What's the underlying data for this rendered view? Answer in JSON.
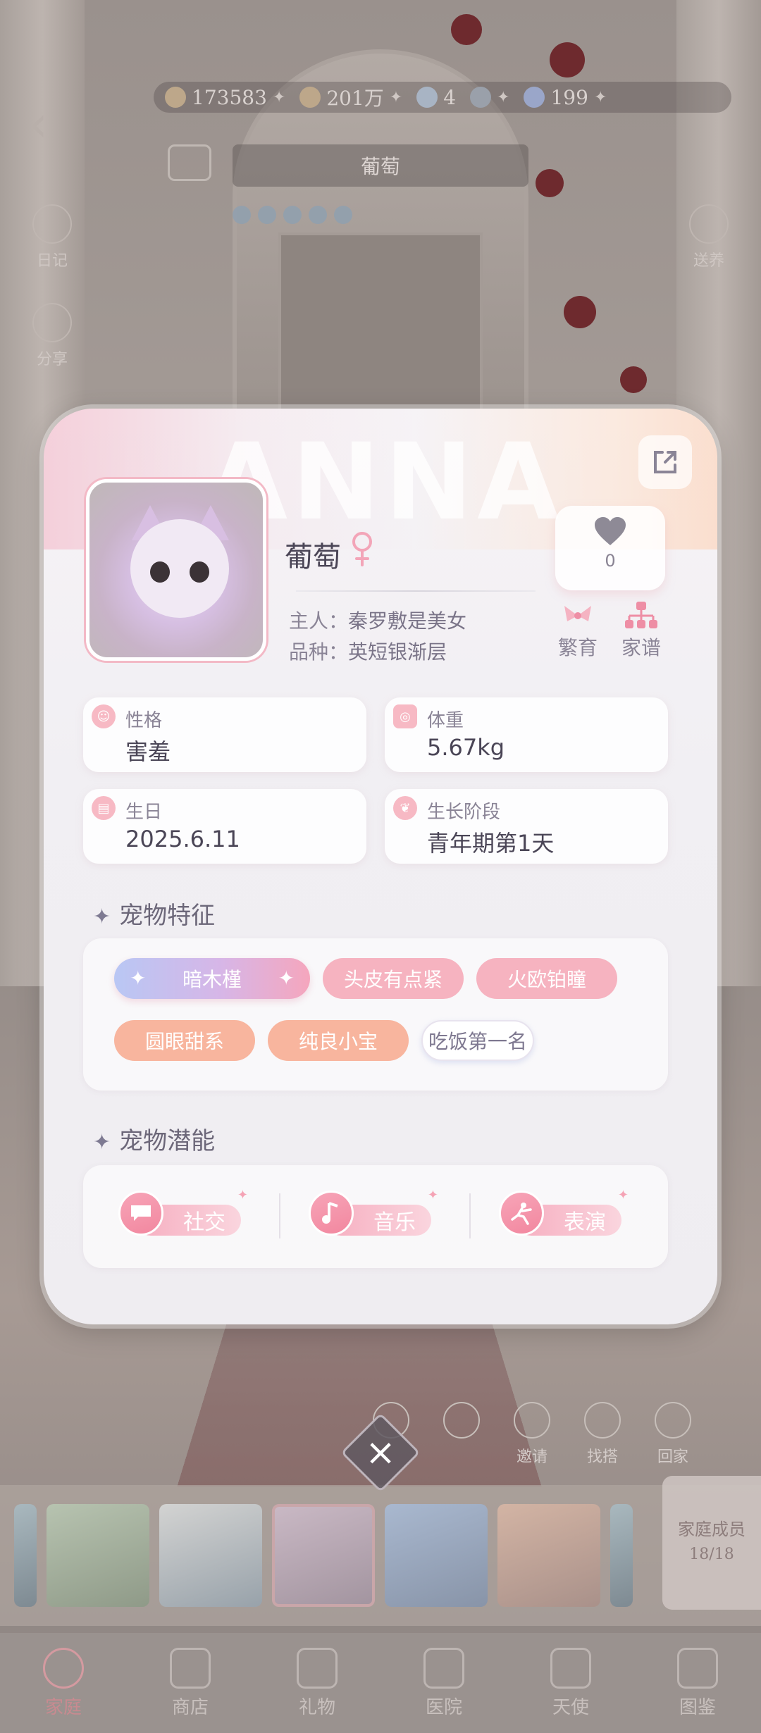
{
  "resources": [
    {
      "icon": "coin-bag-icon",
      "value": "173583"
    },
    {
      "icon": "gold-coin-icon",
      "value": "201万"
    },
    {
      "icon": "diamond-icon",
      "value": "4"
    },
    {
      "icon": "ticket-icon",
      "value": ""
    },
    {
      "icon": "gem-icon",
      "value": "199"
    }
  ],
  "top": {
    "pet_name_bar": "葡萄",
    "left_buttons": [
      "日记",
      "分享"
    ],
    "right_buttons": [
      "送养"
    ]
  },
  "card": {
    "watermark": "ANNA",
    "pet_name": "葡萄",
    "likes": "0",
    "owner_label": "主人：",
    "owner": "秦罗敷是美女",
    "breed_label": "品种：",
    "breed": "英短银渐层",
    "actions": {
      "breed": "繁育",
      "family_tree": "家谱"
    },
    "stats": {
      "personality": {
        "label": "性格",
        "value": "害羞"
      },
      "weight": {
        "label": "体重",
        "value": "5.67kg"
      },
      "birthday": {
        "label": "生日",
        "value": "2025.6.11"
      },
      "stage": {
        "label": "生长阶段",
        "value": "青年期第1天"
      }
    },
    "traits_title": "宠物特征",
    "traits": [
      "暗木槿",
      "头皮有点紧",
      "火欧铂瞳",
      "圆眼甜系",
      "纯良小宝",
      "吃饭第一名"
    ],
    "potential_title": "宠物潜能",
    "potentials": [
      "社交",
      "音乐",
      "表演"
    ]
  },
  "bottom_actions": [
    "",
    "",
    "邀请",
    "找搭",
    "回家"
  ],
  "family": {
    "label": "家庭成员",
    "count": "18/18"
  },
  "nav": [
    "家庭",
    "商店",
    "礼物",
    "医院",
    "天使",
    "图鉴"
  ],
  "colors": {
    "accent_pink": "#f6b3c0",
    "card_bg": "#f3f1f5",
    "text_dark": "#4a4556"
  }
}
